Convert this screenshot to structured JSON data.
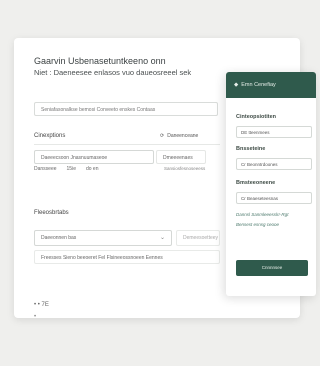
{
  "form": {
    "title": "Gaarvin Usbenasetuntkeeno onn",
    "subtitle": "Niet : Daeneesee enlasos vuo daueosreeel sek",
    "top_field_value": "Seniafasonalkse bemosi Conveeto enskes Contaas",
    "section_label": "Cinexptions",
    "filter_label": "Daneenceane",
    "input1_value": "Daeeecsoon Jnasnuumaseoe",
    "input1_suffix": "Dmeeeenaes",
    "row_items": [
      "Dansseee",
      "15ie",
      "do en"
    ],
    "row_tag": "Sansiosfesnoseeess",
    "section2_label": "Fleeosbrtabs",
    "select_value": "Daeeonnen bas",
    "select_right": "Demeesoetteey",
    "hint_text": "Freesses Sieno beeoeret Fel Flsineeossnoeen Eennes",
    "footer_text": "• •  7E",
    "footer_sub": "•"
  },
  "panel": {
    "header_label": "Emn Cenefiay",
    "label1": "Cinteopsiotiten",
    "input1": "DE tteenmees",
    "label2": "Bnsseteine",
    "input2": "Cr Beonntrdoones",
    "label3": "Bmsteeoneene",
    "input3": "Cr Beaeseteesnas",
    "link1": "Dannsl Sanmleeesslrr-Rgt",
    "link2": "Bensest esnsg ceooe",
    "button_label": "Cnnnnsee"
  }
}
